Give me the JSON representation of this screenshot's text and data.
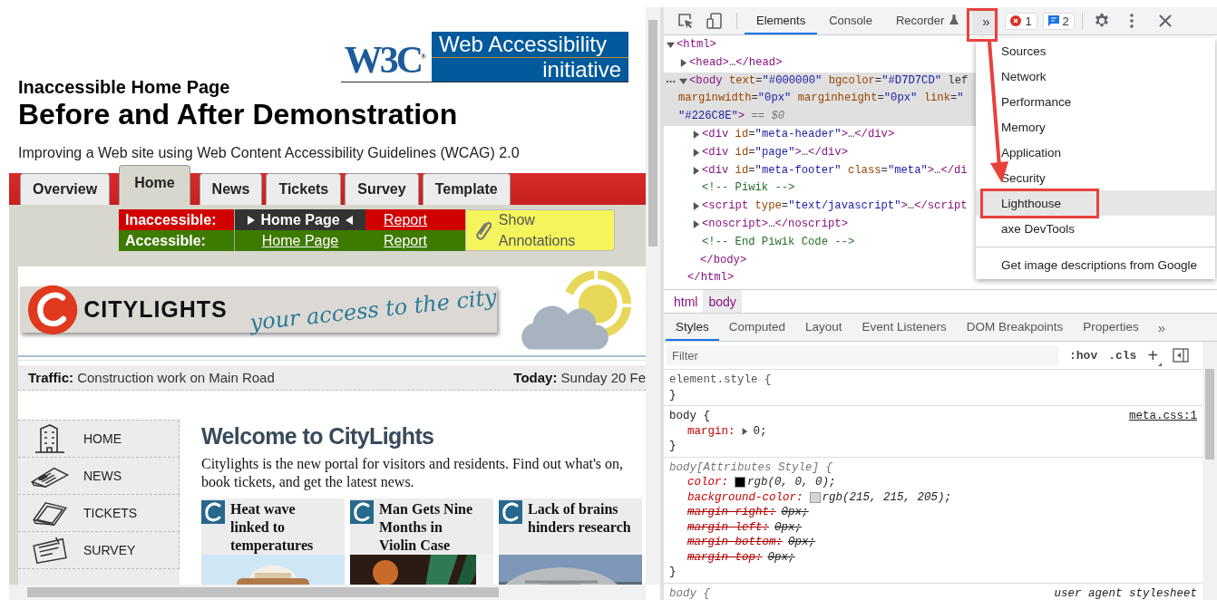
{
  "web_page": {
    "logo": {
      "mark": "W3C$^{®}$",
      "title": "Web Accessibility",
      "subtitle": "initiative"
    },
    "kicker": "Inaccessible Home Page",
    "title": "Before and After Demonstration",
    "tagline": "Improving a Web site using Web Content Accessibility Guidelines (WCAG) 2.0",
    "tabs": [
      {
        "label": "Overview",
        "selected": false
      },
      {
        "label": "Home",
        "selected": true
      },
      {
        "label": "News",
        "selected": false
      },
      {
        "label": "Tickets",
        "selected": false
      },
      {
        "label": "Survey",
        "selected": false
      },
      {
        "label": "Template",
        "selected": false
      }
    ],
    "demo_nav": {
      "rows": [
        {
          "kind": "inaccessible",
          "label": "Inaccessible:",
          "page": "Home Page",
          "current": true,
          "report": "Report"
        },
        {
          "kind": "accessible",
          "label": "Accessible:",
          "page": "Home Page",
          "current": false,
          "report": "Report"
        }
      ],
      "annotations_button": "Show Annotations"
    },
    "site": {
      "name": "CITYLIGHTS",
      "slogan": "your access to the city",
      "ticker": {
        "traffic": "**Traffic:** Construction work on Main Road",
        "today": "**Today:** Sunday 20 Fe"
      },
      "menu": [
        {
          "label": "HOME"
        },
        {
          "label": "NEWS"
        },
        {
          "label": "TICKETS"
        },
        {
          "label": "SURVEY"
        }
      ],
      "welcome": {
        "heading": "Welcome to CityLights",
        "text": "Citylights is the new portal for visitors and residents. Find out what's on, book tickets, and get the latest news."
      },
      "news": [
        {
          "headline": "Heat wave linked to temperatures"
        },
        {
          "headline": "Man Gets Nine Months in Violin Case"
        },
        {
          "headline": "Lack of brains hinders research"
        }
      ]
    }
  },
  "devtools": {
    "tabs": [
      {
        "label": "Elements",
        "selected": true
      },
      {
        "label": "Console",
        "selected": false
      },
      {
        "label": "Recorder",
        "selected": false
      }
    ],
    "more_tabs": {
      "label": "»",
      "annotated": true
    },
    "error_count": "1",
    "message_count": "2",
    "dom_tree": [
      {
        "kind": "element",
        "lines": [
          "<html>"
        ],
        "selected": false,
        "expanded": true,
        "close": "</html>",
        "children": [
          {
            "kind": "element",
            "lines": [
              "<head>…</head>"
            ],
            "selected": false,
            "expanded": false
          },
          {
            "kind": "element",
            "lines": [
              "<body text=\"#000000\" bgcolor=\"#D7D7CD\" lef",
              "marginwidth=\"0px\" marginheight=\"0px\" link=\"",
              "\"#226C8E\">"
            ],
            "marker": "== $0",
            "selected": true,
            "expanded": true,
            "close": "</body>",
            "children": [
              {
                "kind": "element",
                "lines": [
                  "<div id=\"meta-header\">…</div>"
                ],
                "selected": false,
                "expanded": false
              },
              {
                "kind": "element",
                "lines": [
                  "<div id=\"page\">…</div>"
                ],
                "selected": false,
                "expanded": false
              },
              {
                "kind": "element",
                "lines": [
                  "<div id=\"meta-footer\" class=\"meta\">…</di"
                ],
                "selected": false,
                "expanded": false
              },
              {
                "kind": "comment",
                "lines": [
                  "<!-- Piwik -->"
                ],
                "selected": false
              },
              {
                "kind": "element",
                "lines": [
                  "<script type=\"text/javascript\">…</script"
                ],
                "selected": false,
                "expanded": false
              },
              {
                "kind": "element",
                "lines": [
                  "<noscript>…</noscript>"
                ],
                "selected": false,
                "expanded": false
              },
              {
                "kind": "comment",
                "lines": [
                  "<!-- End Piwik Code -->"
                ],
                "selected": false
              }
            ]
          }
        ]
      }
    ],
    "overflow_menu": [
      [
        {
          "label": "Sources",
          "highlighted": false
        },
        {
          "label": "Network",
          "highlighted": false
        },
        {
          "label": "Performance",
          "highlighted": false
        },
        {
          "label": "Memory",
          "highlighted": false
        },
        {
          "label": "Application",
          "highlighted": false
        },
        {
          "label": "Security",
          "highlighted": false
        },
        {
          "label": "Lighthouse",
          "highlighted": true
        },
        {
          "label": "axe DevTools",
          "highlighted": false
        }
      ],
      [
        {
          "label": "Get image descriptions from Google",
          "highlighted": false
        }
      ]
    ],
    "breadcrumbs": [
      {
        "label": "html",
        "selected": false
      },
      {
        "label": "body",
        "selected": true
      }
    ],
    "styles_tabs": [
      {
        "label": "Styles",
        "selected": true
      },
      {
        "label": "Computed",
        "selected": false
      },
      {
        "label": "Layout",
        "selected": false
      },
      {
        "label": "Event Listeners",
        "selected": false
      },
      {
        "label": "DOM Breakpoints",
        "selected": false
      },
      {
        "label": "Properties",
        "selected": false
      }
    ],
    "styles_more": "»",
    "filter": {
      "placeholder": "Filter"
    },
    "hov": ":hov",
    "cls": ".cls",
    "new_rule": "+",
    "rules": [
      {
        "kind": "inline",
        "selector": "element.style {",
        "close": "}"
      },
      {
        "kind": "author",
        "selector": "body {",
        "source": "meta.css:1",
        "close": "}",
        "declarations": [
          {
            "property": "margin:",
            "value": "0;",
            "expandable": true,
            "overridden": false
          }
        ]
      },
      {
        "kind": "attributes",
        "selector": "body[Attributes Style] {",
        "close": "}",
        "declarations": [
          {
            "property": "color:",
            "value": "rgb(0, 0, 0);",
            "color": "#000000",
            "expandable": false,
            "overridden": false
          },
          {
            "property": "background-color:",
            "value": "rgb(215, 215, 205);",
            "color": "#d7d7cd",
            "expandable": false,
            "overridden": false
          },
          {
            "property": "margin-right:",
            "value": "0px;",
            "expandable": false,
            "overridden": true
          },
          {
            "property": "margin-left:",
            "value": "0px;",
            "expandable": false,
            "overridden": true
          },
          {
            "property": "margin-bottom:",
            "value": "0px;",
            "expandable": false,
            "overridden": true
          },
          {
            "property": "margin-top:",
            "value": "0px;",
            "expandable": false,
            "overridden": true
          }
        ]
      },
      {
        "kind": "user_agent",
        "selector": "body {",
        "source": "user agent stylesheet"
      }
    ]
  }
}
